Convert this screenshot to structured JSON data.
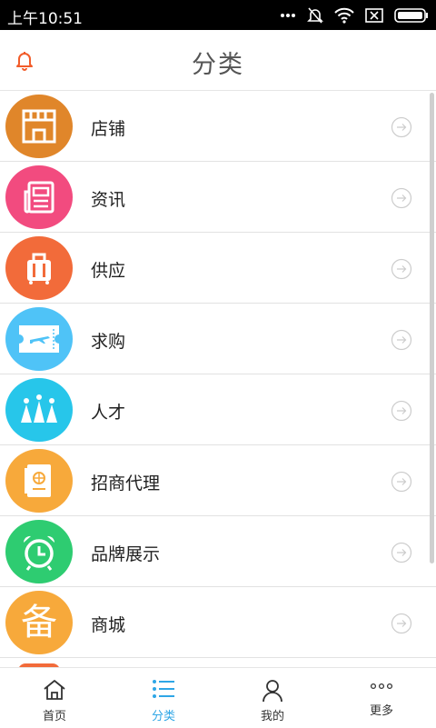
{
  "status_bar": {
    "time": "上午10:51",
    "icons": [
      "dots-icon",
      "mute-icon",
      "wifi-icon",
      "sim-x-icon",
      "battery-icon"
    ]
  },
  "header": {
    "title": "分类",
    "left_icon": "bell-icon"
  },
  "colors": {
    "accent": "#2ea6e6",
    "bell": "#f25c2a"
  },
  "categories": [
    {
      "label": "店铺",
      "icon": "shop-icon",
      "color": "#e0862a"
    },
    {
      "label": "资讯",
      "icon": "newspaper-icon",
      "color": "#f24b7f"
    },
    {
      "label": "供应",
      "icon": "suitcase-icon",
      "color": "#f26b3a"
    },
    {
      "label": "求购",
      "icon": "ticket-icon",
      "color": "#4fc3f7"
    },
    {
      "label": "人才",
      "icon": "crown-icon",
      "color": "#27c6ea"
    },
    {
      "label": "招商代理",
      "icon": "passport-icon",
      "color": "#f7a93b"
    },
    {
      "label": "品牌展示",
      "icon": "alarm-clock-icon",
      "color": "#2ecc71"
    },
    {
      "label": "商城",
      "icon": "bei-character-icon",
      "color": "#f7a93b",
      "glyph": "备"
    }
  ],
  "tabbar": {
    "items": [
      {
        "label": "首页",
        "icon": "home-icon",
        "active": false
      },
      {
        "label": "分类",
        "icon": "list-icon",
        "active": true
      },
      {
        "label": "我的",
        "icon": "user-icon",
        "active": false
      },
      {
        "label": "更多",
        "icon": "more-icon",
        "active": false
      }
    ]
  }
}
